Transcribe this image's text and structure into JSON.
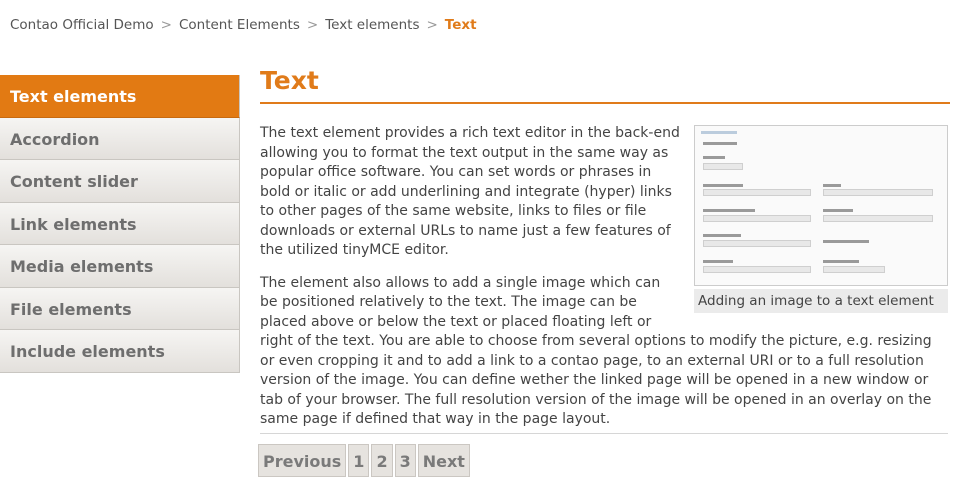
{
  "breadcrumb": {
    "items": [
      "Contao Official Demo",
      "Content Elements",
      "Text elements"
    ],
    "separator": ">",
    "current": "Text"
  },
  "sidebar": {
    "items": [
      {
        "label": "Text elements",
        "active": true
      },
      {
        "label": "Accordion"
      },
      {
        "label": "Content slider"
      },
      {
        "label": "Link elements"
      },
      {
        "label": "Media elements"
      },
      {
        "label": "File elements"
      },
      {
        "label": "Include elements"
      }
    ]
  },
  "main": {
    "title": "Text",
    "paragraphs": [
      "The text element provides a rich text editor in the back-end allowing you to format the text output in the same way as popular office software. You can set words or phrases in bold or italic or add underlining and integrate (hyper) links to other pages of the same website, links to files or file downloads or external URLs to name just a few features of the utilized tinyMCE editor.",
      "The element also allows to add a single image which can be positioned relatively to the text. The image can be placed above or below the text or placed floating left or right of the text. You are able to choose from several options to modify the picture, e.g. resizing or even cropping it and to add a link to a contao page, to an external URI or to a full resolution version of the image. You can define wether the linked page will be opened in a new window or tab of your browser. The full resolution version of the image will be opened in an overlay on the same page if defined that way in the page layout."
    ],
    "figure": {
      "caption": "Adding an image to a text element"
    }
  },
  "pagination": {
    "previous": "Previous",
    "pages": [
      "1",
      "2",
      "3"
    ],
    "next": "Next"
  },
  "colors": {
    "accent": "#e27a13"
  }
}
